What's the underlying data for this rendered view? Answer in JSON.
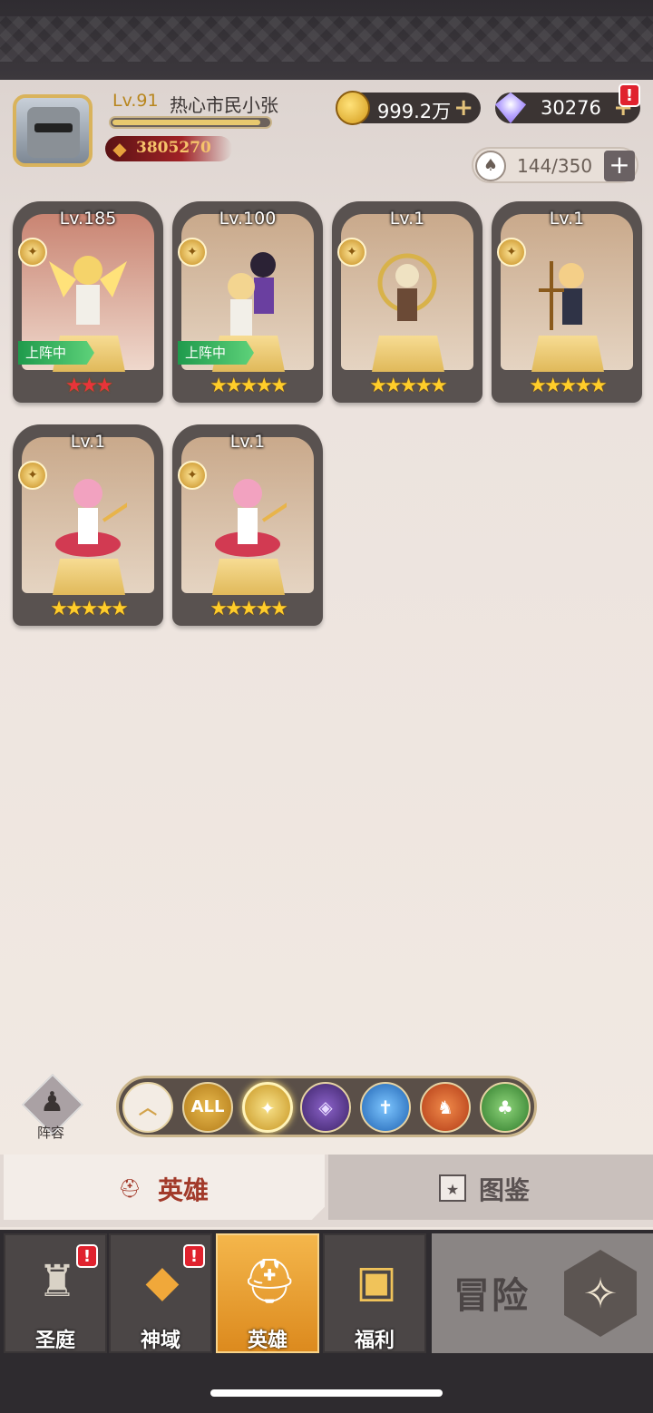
{
  "player": {
    "level": "Lv.91",
    "name": "热心市民小张",
    "power": "3805270",
    "xp_fraction": 0.95
  },
  "resources": {
    "gold": "999.2万",
    "diamonds": "30276",
    "alert": "!",
    "hero_capacity": "144/350"
  },
  "heroes": [
    {
      "level": "Lv.185",
      "stars": "★★★",
      "star_color": "red",
      "deployed": "上阵中"
    },
    {
      "level": "Lv.100",
      "stars": "★★★★★",
      "star_color": "gold",
      "deployed": "上阵中"
    },
    {
      "level": "Lv.1",
      "stars": "★★★★★",
      "star_color": "gold",
      "deployed": ""
    },
    {
      "level": "Lv.1",
      "stars": "★★★★★",
      "star_color": "gold",
      "deployed": ""
    },
    {
      "level": "Lv.1",
      "stars": "★★★★★",
      "star_color": "gold",
      "deployed": ""
    },
    {
      "level": "Lv.1",
      "stars": "★★★★★",
      "star_color": "gold",
      "deployed": ""
    }
  ],
  "lineup_label": "阵容",
  "filters": [
    {
      "icon": "chevron-up-icon",
      "label": ""
    },
    {
      "icon": "all-icon",
      "label": "ALL"
    },
    {
      "icon": "light-element-icon",
      "label": ""
    },
    {
      "icon": "dark-element-icon",
      "label": ""
    },
    {
      "icon": "water-element-icon",
      "label": ""
    },
    {
      "icon": "fire-element-icon",
      "label": ""
    },
    {
      "icon": "nature-element-icon",
      "label": ""
    }
  ],
  "subtabs": {
    "heroes": "英雄",
    "codex": "图鉴"
  },
  "nav": {
    "sanctuary": "圣庭",
    "divine": "神域",
    "heroes": "英雄",
    "welfare": "福利",
    "adventure": "冒险"
  }
}
